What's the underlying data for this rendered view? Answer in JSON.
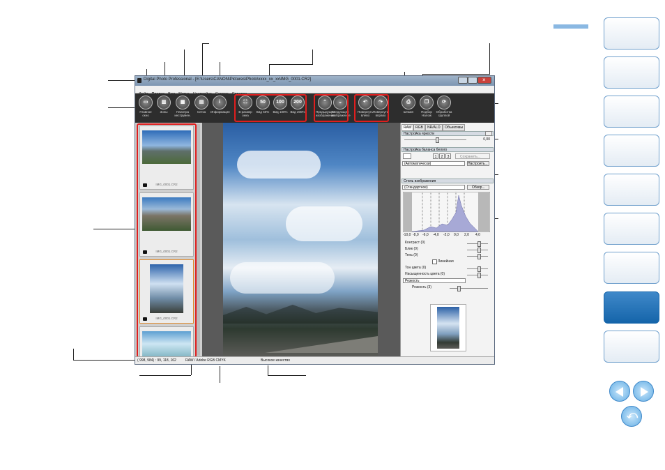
{
  "app": {
    "title": "Digital Photo Professional - [E:\\Users\\CANON\\Pictures\\Photo\\xxxx_xx_xx\\IMG_0001.CR2]",
    "colors": {
      "highlight": "#e01e1e",
      "accent": "#1565aa"
    }
  },
  "menu": [
    "Файл",
    "Правка",
    "Вид",
    "Метка",
    "Настройка",
    "Сервис",
    "Справка"
  ],
  "toolbar": [
    {
      "label": "Главное\nокно",
      "icon": "main-window-icon",
      "glyph": "▭"
    },
    {
      "label": "Зоны",
      "icon": "zones-icon",
      "glyph": "▥"
    },
    {
      "label": "Палитра\nинструмен.",
      "icon": "tool-palette-icon",
      "glyph": "▦"
    },
    {
      "label": "Сетка",
      "icon": "grid-icon",
      "glyph": "▤"
    },
    {
      "label": "Информация",
      "icon": "info-icon",
      "glyph": "i"
    },
    {
      "label": "В размер\nокна",
      "icon": "fit-window-icon",
      "glyph": "⛶"
    },
    {
      "label": "Вид 50%",
      "icon": "view-50-icon",
      "glyph": "50"
    },
    {
      "label": "Вид 100%",
      "icon": "view-100-icon",
      "glyph": "100"
    },
    {
      "label": "Вид 200%",
      "icon": "view-200-icon",
      "glyph": "200"
    },
    {
      "label": "Предыдущее\nизображение",
      "icon": "previous-image-icon",
      "glyph": "⌃"
    },
    {
      "label": "Следующее\nизображение",
      "icon": "next-image-icon",
      "glyph": "⌄"
    },
    {
      "label": "Повернуть\nвлево",
      "icon": "rotate-left-icon",
      "glyph": "↶"
    },
    {
      "label": "Повернуть\nвправо",
      "icon": "rotate-right-icon",
      "glyph": "↷"
    },
    {
      "label": "Штамп",
      "icon": "stamp-icon",
      "glyph": "⎙"
    },
    {
      "label": "Подбор\nНалож",
      "icon": "composite-icon",
      "glyph": "❐"
    },
    {
      "label": "Обработка\nгруппой",
      "icon": "batch-process-icon",
      "glyph": "⟳"
    }
  ],
  "thumbnails": [
    {
      "caption": "IMG_0001.CR2"
    },
    {
      "caption": "IMG_0001.CR2"
    },
    {
      "caption": "IMG_0001.CR2"
    },
    {
      "caption": ""
    }
  ],
  "panel": {
    "tabs": [
      "RAW",
      "RGB",
      "NR/ALO",
      "Объективы"
    ],
    "brightness": {
      "title": "Настройка яркости",
      "value": "0,00"
    },
    "white_balance": {
      "title": "Настройка баланса белого",
      "presets": [
        "1",
        "2",
        "3"
      ],
      "save_label": "Сохранить...",
      "mode": "(Автоматически)",
      "adjust_label": "Настроить..."
    },
    "picture_style": {
      "title": "Стиль изображения",
      "selected": "(Стандартное)",
      "browse_label": "Обзор..."
    },
    "histogram": {
      "axis_ticks": [
        "-10,0",
        "-8,0",
        "-6,0",
        "-4,0",
        "-2,0",
        "0,0",
        "2,0",
        "4,0"
      ]
    },
    "controls": {
      "contrast": "Контраст (0)",
      "highlight": "Блик (0)",
      "shadow": "Тень (0)",
      "linear": "Линейная",
      "color_tone": "Тон цвета (0)",
      "saturation": "Насыщенность цвета (0)",
      "sharpness_mode": "Резкость",
      "sharpness": "Резкость (3)"
    }
  },
  "status": {
    "coords": "( 998, 984) : 99, 118, 162",
    "format": "RAW / Adobe RGB CMYK",
    "quality": "Высокое качество"
  }
}
